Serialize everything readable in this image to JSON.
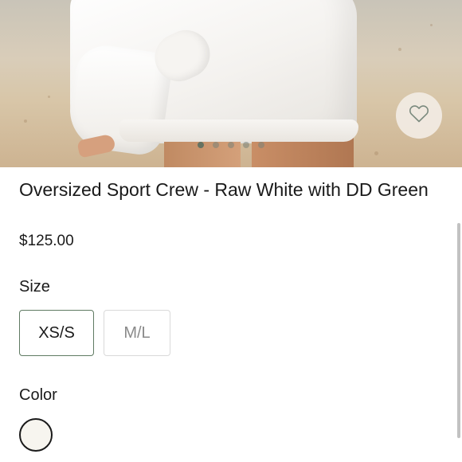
{
  "product": {
    "title": "Oversized Sport Crew - Raw White with DD Green",
    "price": "$125.00",
    "wishlist_icon": "heart-outline-icon",
    "image_carousel": {
      "dot_count": 5,
      "active_index": 0
    }
  },
  "size": {
    "label": "Size",
    "options": [
      {
        "label": "XS/S",
        "selected": true
      },
      {
        "label": "M/L",
        "selected": false
      }
    ]
  },
  "color": {
    "label": "Color",
    "swatches": [
      {
        "color": "#f7f5ef",
        "selected": true
      }
    ]
  },
  "colors": {
    "accent_border": "#5f7a62",
    "text": "#1a1a1a",
    "muted_text": "#8a8a8a",
    "wishlist_bg": "#f2ece4"
  }
}
